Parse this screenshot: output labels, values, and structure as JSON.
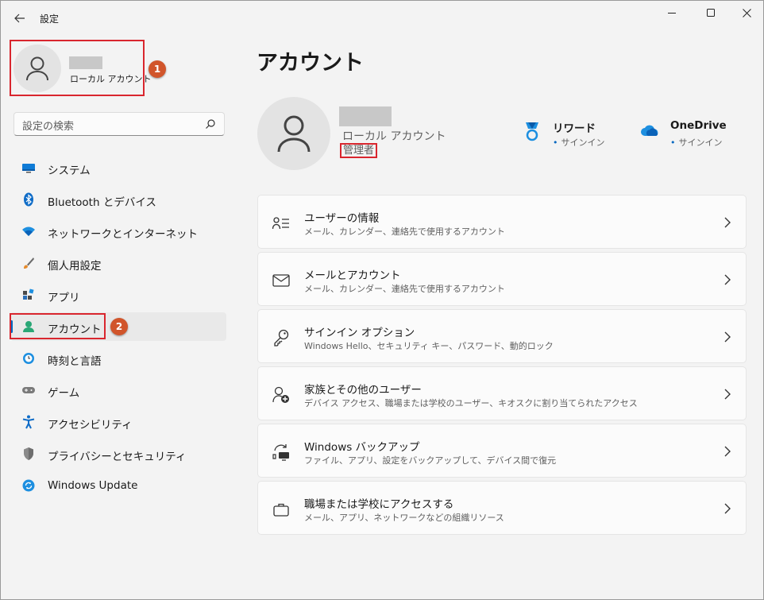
{
  "window": {
    "title": "設定",
    "icons": {
      "back": "back-arrow-icon",
      "minimize": "minimize-icon",
      "maximize": "maximize-icon",
      "close": "close-icon"
    }
  },
  "sidebar": {
    "profile": {
      "account_type": "ローカル アカウント",
      "badge": "1"
    },
    "search": {
      "placeholder": "設定の検索"
    },
    "items": [
      {
        "label": "システム",
        "icon": "system-icon"
      },
      {
        "label": "Bluetooth とデバイス",
        "icon": "bluetooth-icon"
      },
      {
        "label": "ネットワークとインターネット",
        "icon": "network-icon"
      },
      {
        "label": "個人用設定",
        "icon": "personalization-icon"
      },
      {
        "label": "アプリ",
        "icon": "apps-icon"
      },
      {
        "label": "アカウント",
        "icon": "accounts-icon",
        "active": true,
        "badge": "2"
      },
      {
        "label": "時刻と言語",
        "icon": "time-language-icon"
      },
      {
        "label": "ゲーム",
        "icon": "gaming-icon"
      },
      {
        "label": "アクセシビリティ",
        "icon": "accessibility-icon"
      },
      {
        "label": "プライバシーとセキュリティ",
        "icon": "privacy-icon"
      },
      {
        "label": "Windows Update",
        "icon": "windows-update-icon"
      }
    ]
  },
  "main": {
    "title": "アカウント",
    "user": {
      "account_type": "ローカル アカウント",
      "role": "管理者"
    },
    "services": [
      {
        "name": "リワード",
        "status": "サインイン",
        "icon": "rewards-icon"
      },
      {
        "name": "OneDrive",
        "status": "サインイン",
        "icon": "onedrive-icon"
      }
    ],
    "cards": [
      {
        "title": "ユーザーの情報",
        "desc": "メール、カレンダー、連絡先で使用するアカウント",
        "icon": "user-info-icon"
      },
      {
        "title": "メールとアカウント",
        "desc": "メール、カレンダー、連絡先で使用するアカウント",
        "icon": "mail-icon"
      },
      {
        "title": "サインイン オプション",
        "desc": "Windows Hello、セキュリティ キー、パスワード、動的ロック",
        "icon": "key-icon"
      },
      {
        "title": "家族とその他のユーザー",
        "desc": "デバイス アクセス、職場または学校のユーザー、キオスクに割り当てられたアクセス",
        "icon": "family-icon"
      },
      {
        "title": "Windows バックアップ",
        "desc": "ファイル、アプリ、設定をバックアップして、デバイス間で復元",
        "icon": "backup-icon"
      },
      {
        "title": "職場または学校にアクセスする",
        "desc": "メール、アプリ、ネットワークなどの組織リソース",
        "icon": "briefcase-icon"
      }
    ]
  },
  "colors": {
    "accent": "#0067c0",
    "highlight": "#d9262e",
    "badge": "#d1552b"
  }
}
